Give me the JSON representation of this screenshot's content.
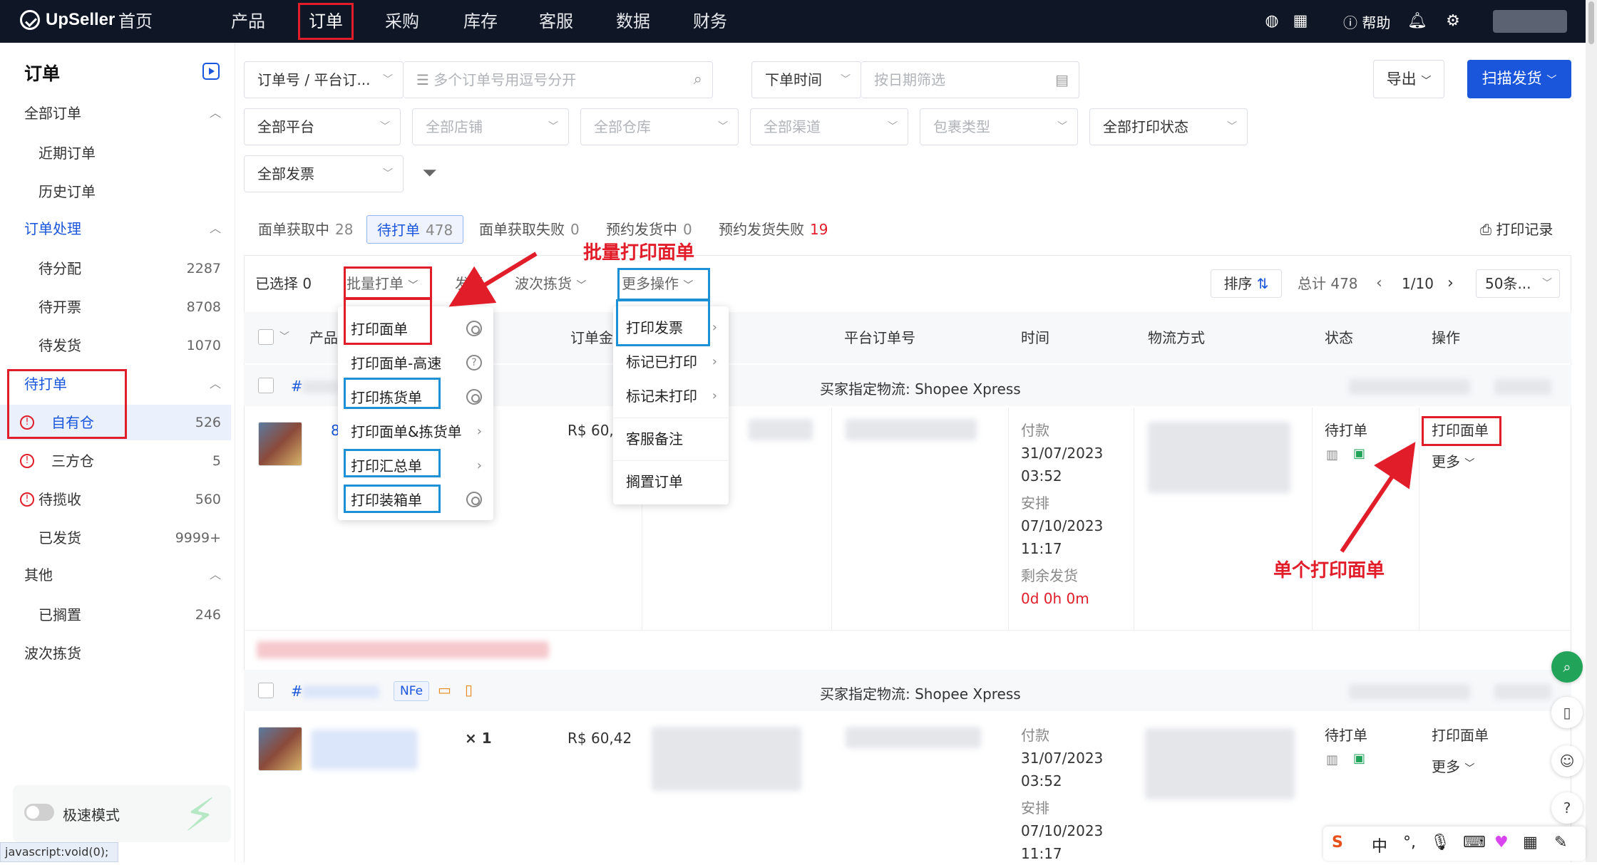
{
  "app": {
    "name": "UpSeller"
  },
  "nav": {
    "items": [
      "首页",
      "产品",
      "订单",
      "采购",
      "库存",
      "客服",
      "数据",
      "财务"
    ],
    "help": "帮助"
  },
  "sidebar": {
    "title": "订单",
    "groups": [
      {
        "label": "全部订单",
        "children": [
          {
            "label": "近期订单"
          },
          {
            "label": "历史订单"
          }
        ]
      },
      {
        "label": "订单处理",
        "children": [
          {
            "label": "待分配",
            "count": "2287"
          },
          {
            "label": "待开票",
            "count": "8708"
          },
          {
            "label": "待发货",
            "count": "1070"
          }
        ]
      },
      {
        "label": "待打单",
        "children": [
          {
            "label": "自有仓",
            "count": "526"
          },
          {
            "label": "三方仓",
            "count": "5"
          }
        ]
      }
    ],
    "pending_pickup": {
      "label": "待揽收",
      "count": "560"
    },
    "shipped": {
      "label": "已发货",
      "count": "9999+"
    },
    "other": {
      "label": "其他",
      "children": [
        {
          "label": "已搁置",
          "count": "246"
        }
      ]
    },
    "wave": "波次拣货",
    "speed_mode": "极速模式",
    "statusbar": "javascript:void(0);"
  },
  "filters": {
    "order_type": "订单号 / 平台订...",
    "search_placeholder": "多个订单号用逗号分开",
    "time": "下单时间",
    "date_placeholder": "按日期筛选",
    "platform": "全部平台",
    "store": "全部店铺",
    "warehouse": "全部仓库",
    "channel": "全部渠道",
    "package": "包裹类型",
    "print_status": "全部打印状态",
    "invoice": "全部发票"
  },
  "actions": {
    "export": "导出",
    "scan": "扫描发货"
  },
  "tabs": [
    {
      "label": "面单获取中",
      "count": "28"
    },
    {
      "label": "待打单",
      "count": "478"
    },
    {
      "label": "面单获取失败",
      "count": "0"
    },
    {
      "label": "预约发货中",
      "count": "0"
    },
    {
      "label": "预约发货失败",
      "count": "19"
    }
  ],
  "print_log": "打印记录",
  "toolbar": {
    "selected": "已选择 0",
    "batch": "批量打单",
    "ship": "发货",
    "wave": "波次拣货",
    "more": "更多操作",
    "sort": "排序",
    "total": "总计 478",
    "page": "1/10",
    "per_page": "50条..."
  },
  "batch_menu": [
    "打印面单",
    "打印面单-高速",
    "打印拣货单",
    "打印面单&拣货单",
    "打印汇总单",
    "打印装箱单"
  ],
  "more_menu": [
    "打印发票",
    "标记已打印",
    "标记未打印",
    "客服备注",
    "搁置订单"
  ],
  "columns": [
    "产品",
    "订单金",
    "平台订单号",
    "时间",
    "物流方式",
    "状态",
    "操作"
  ],
  "orders": [
    {
      "prefix": "#",
      "ship_note": "买家指定物流: Shopee Xpress",
      "amount": "R$ 60,",
      "pay_label": "付款",
      "pay_date": "31/07/2023",
      "pay_time": "03:52",
      "arr_label": "安排",
      "arr_date": "07/10/2023",
      "arr_time": "11:17",
      "remain_label": "剩余发货",
      "remain": "0d 0h 0m",
      "status": "待打单",
      "op_print": "打印面单",
      "op_more": "更多"
    },
    {
      "prefix": "#",
      "badge": "NFe",
      "ship_note": "买家指定物流: Shopee Xpress",
      "qty": "× 1",
      "amount": "R$ 60,42",
      "pay_label": "付款",
      "pay_date": "31/07/2023",
      "pay_time": "03:52",
      "arr_label": "安排",
      "arr_date": "07/10/2023",
      "arr_time": "11:17",
      "status": "待打单",
      "op_print": "打印面单",
      "op_more": "更多"
    }
  ],
  "annotations": {
    "batch": "批量打印面单",
    "single": "单个打印面单"
  },
  "ime": {
    "lang": "中"
  },
  "colors": {
    "nav_bg": "#0f1726",
    "primary": "#1a56db",
    "annotation": "#e11d2a",
    "highlight_blue": "#1e90d6"
  }
}
